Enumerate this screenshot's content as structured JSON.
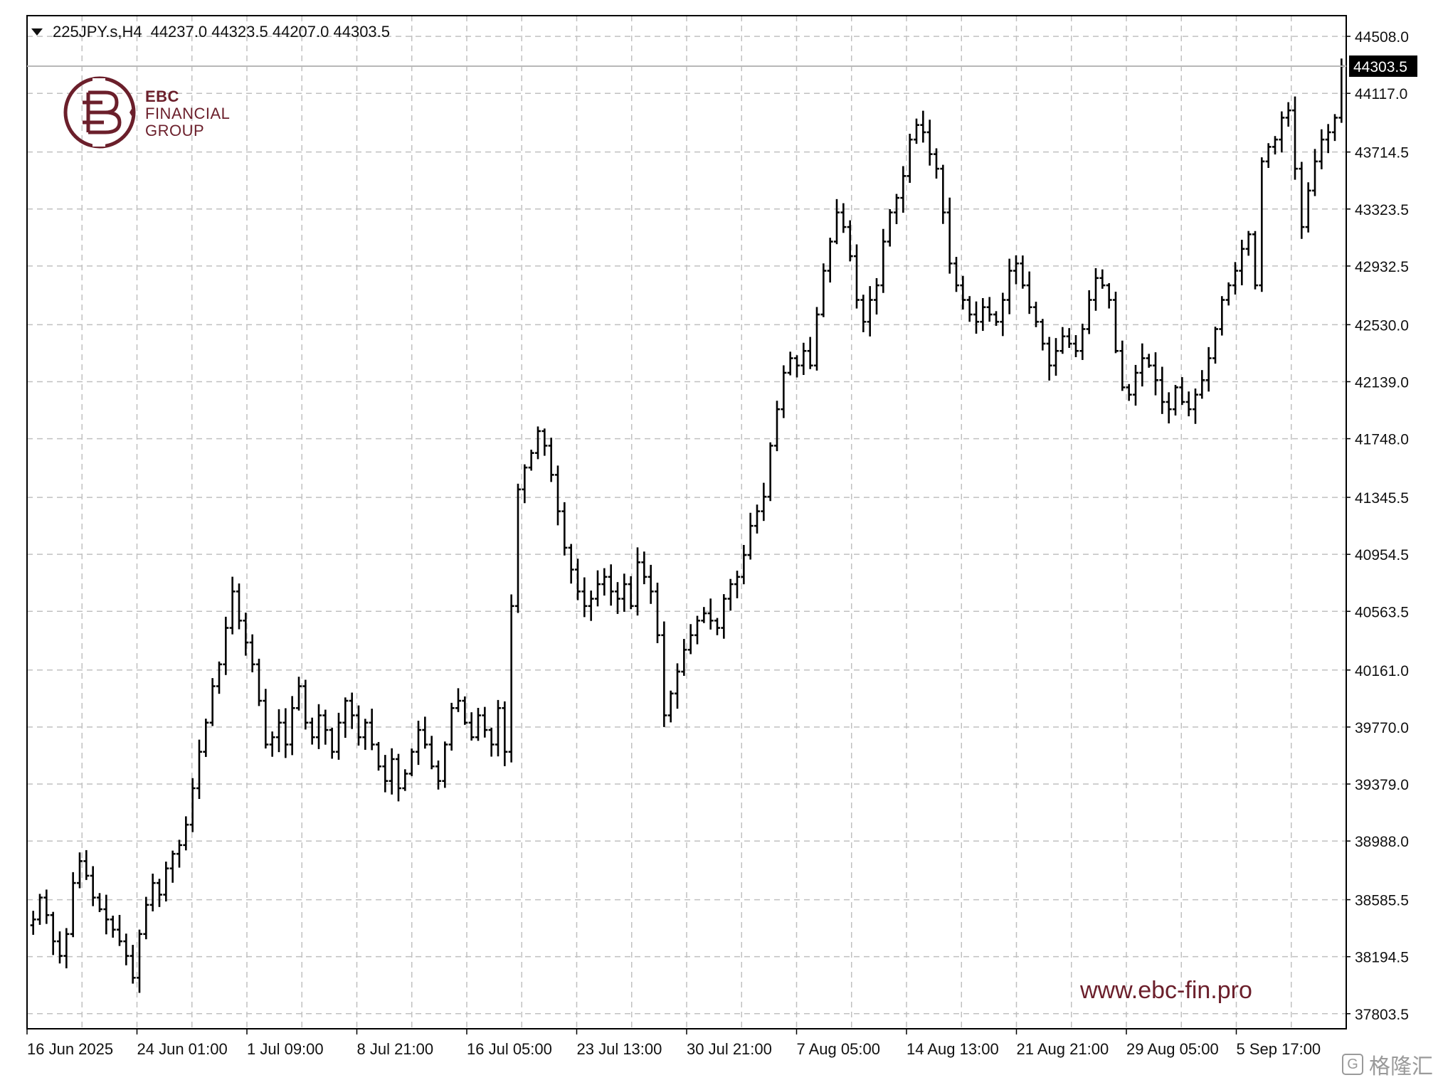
{
  "header": {
    "symbol": "225JPY.s,H4",
    "ohlc": "44237.0 44323.5 44207.0 44303.5"
  },
  "logo": {
    "line1": "EBC",
    "line2": "FINANCIAL",
    "line3": "GROUP"
  },
  "website": "www.ebc-fin.pro",
  "watermark": "格隆汇",
  "colors": {
    "bars": "#000000",
    "grid": "#c0c0c0",
    "brand": "#6b1f2b",
    "last_price_bg": "#000000",
    "last_price_fg": "#ffffff"
  },
  "chart_data": {
    "type": "ohlc",
    "title": "",
    "xlabel": "",
    "ylabel": "",
    "timeframe": "H4",
    "grid": true,
    "ylim": [
      37700,
      44650
    ],
    "y_ticks": [
      "44508.0",
      "44117.0",
      "43714.5",
      "43323.5",
      "42932.5",
      "42530.0",
      "42139.0",
      "41748.0",
      "41345.5",
      "40954.5",
      "40563.5",
      "40161.0",
      "39770.0",
      "39379.0",
      "38988.0",
      "38585.5",
      "38194.5",
      "37803.5"
    ],
    "x_ticks": [
      "16 Jun 2025",
      "24 Jun 01:00",
      "1 Jul 09:00",
      "8 Jul 21:00",
      "16 Jul 05:00",
      "23 Jul 13:00",
      "30 Jul 21:00",
      "7 Aug 05:00",
      "14 Aug 13:00",
      "21 Aug 21:00",
      "29 Aug 05:00",
      "5 Sep 17:00"
    ],
    "last_price": "44303.5",
    "closes": [
      38450,
      38600,
      38480,
      38300,
      38200,
      38350,
      38700,
      38850,
      38750,
      38600,
      38520,
      38450,
      38380,
      38300,
      38200,
      38050,
      38350,
      38550,
      38700,
      38620,
      38800,
      38900,
      38960,
      39100,
      39350,
      39600,
      39800,
      40050,
      40200,
      40450,
      40700,
      40500,
      40350,
      40200,
      39950,
      39650,
      39700,
      39800,
      39650,
      39900,
      40050,
      39800,
      39700,
      39850,
      39750,
      39600,
      39800,
      39950,
      39850,
      39700,
      39800,
      39650,
      39500,
      39400,
      39550,
      39350,
      39450,
      39600,
      39750,
      39650,
      39500,
      39400,
      39650,
      39900,
      39950,
      39800,
      39700,
      39850,
      39750,
      39650,
      39900,
      39600,
      40600,
      41400,
      41550,
      41650,
      41800,
      41700,
      41500,
      41250,
      41000,
      40850,
      40700,
      40600,
      40650,
      40750,
      40800,
      40700,
      40650,
      40750,
      40600,
      40900,
      40800,
      40700,
      40400,
      39850,
      40000,
      40150,
      40300,
      40400,
      40500,
      40550,
      40500,
      40450,
      40650,
      40750,
      40800,
      40950,
      41150,
      41250,
      41350,
      41700,
      41950,
      42200,
      42300,
      42250,
      42350,
      42250,
      42600,
      42900,
      43100,
      43300,
      43200,
      43000,
      42700,
      42550,
      42700,
      42800,
      43100,
      43300,
      43400,
      43550,
      43800,
      43900,
      43850,
      43700,
      43600,
      43300,
      42950,
      42800,
      42700,
      42600,
      42550,
      42650,
      42600,
      42550,
      42700,
      42900,
      42950,
      42800,
      42650,
      42550,
      42400,
      42250,
      42350,
      42450,
      42400,
      42350,
      42500,
      42700,
      42850,
      42800,
      42700,
      42350,
      42100,
      42050,
      42200,
      42300,
      42250,
      42150,
      42000,
      41950,
      42100,
      42000,
      41950,
      42050,
      42150,
      42300,
      42500,
      42700,
      42800,
      42900,
      43050,
      43150,
      42800,
      43650,
      43750,
      43800,
      43950,
      44000,
      43600,
      43200,
      43450,
      43650,
      43800,
      43850,
      43950,
      44303.5
    ]
  }
}
